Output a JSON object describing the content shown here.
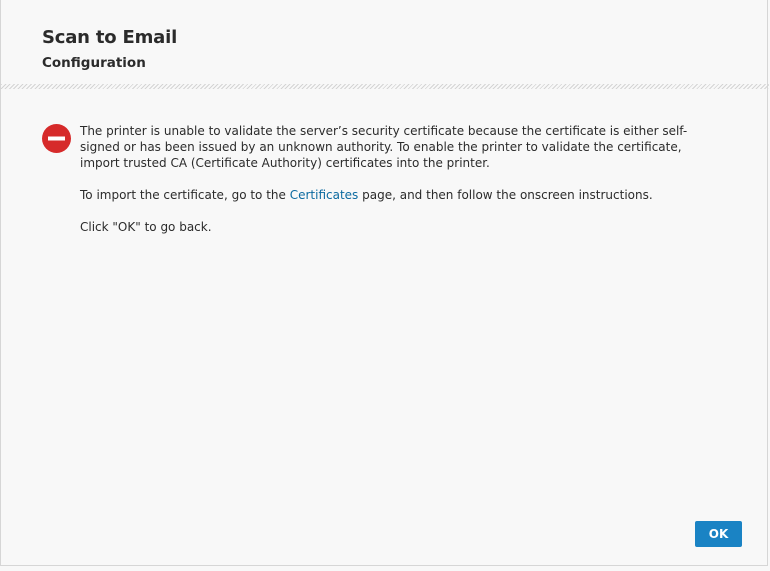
{
  "header": {
    "title": "Scan to Email",
    "subtitle": "Configuration"
  },
  "error": {
    "icon": "error-stop-icon",
    "icon_color": "#d62a2a",
    "paragraph1": "The printer is unable to validate the server’s security certificate because the certificate is either self-signed or has been issued by an unknown authority. To enable the printer to validate the certificate, import trusted CA (Certificate Authority) certificates into the printer.",
    "paragraph2_prefix": "To import the certificate, go to the ",
    "paragraph2_link": "Certificates",
    "paragraph2_suffix": " page, and then follow the onscreen instructions.",
    "paragraph3": "Click \"OK\" to go back."
  },
  "footer": {
    "ok_label": "OK",
    "ok_color": "#1a83c4"
  },
  "colors": {
    "link": "#0b6aa0",
    "text": "#2b2b2b",
    "background": "#f8f8f8"
  }
}
